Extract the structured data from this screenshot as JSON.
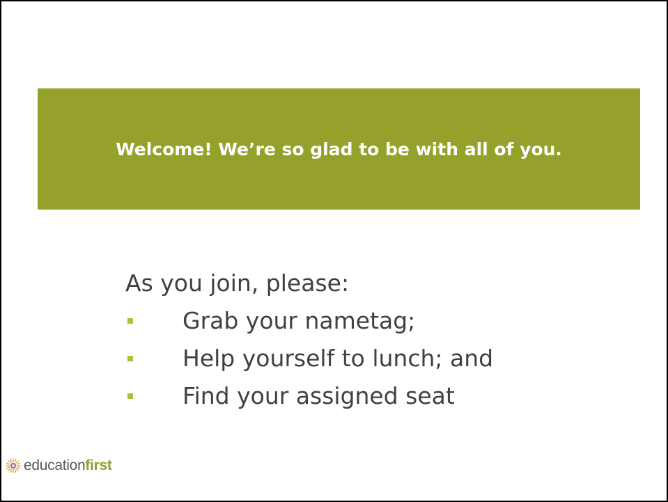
{
  "colors": {
    "banner_bg": "#95a12a",
    "bullet": "#a9c23f",
    "body_text": "#404040",
    "logo_strong": "#8aa22e"
  },
  "banner": {
    "text": "Welcome! We’re so glad to be with all of you."
  },
  "content": {
    "intro": "As you join, please:",
    "bullets": [
      "Grab your nametag;",
      "Help yourself to lunch; and",
      "Find your assigned seat"
    ],
    "bullet_icon": "square-bullet-icon"
  },
  "logo": {
    "icon": "sunburst-logo-icon",
    "text_regular": "education",
    "text_bold": "first"
  }
}
